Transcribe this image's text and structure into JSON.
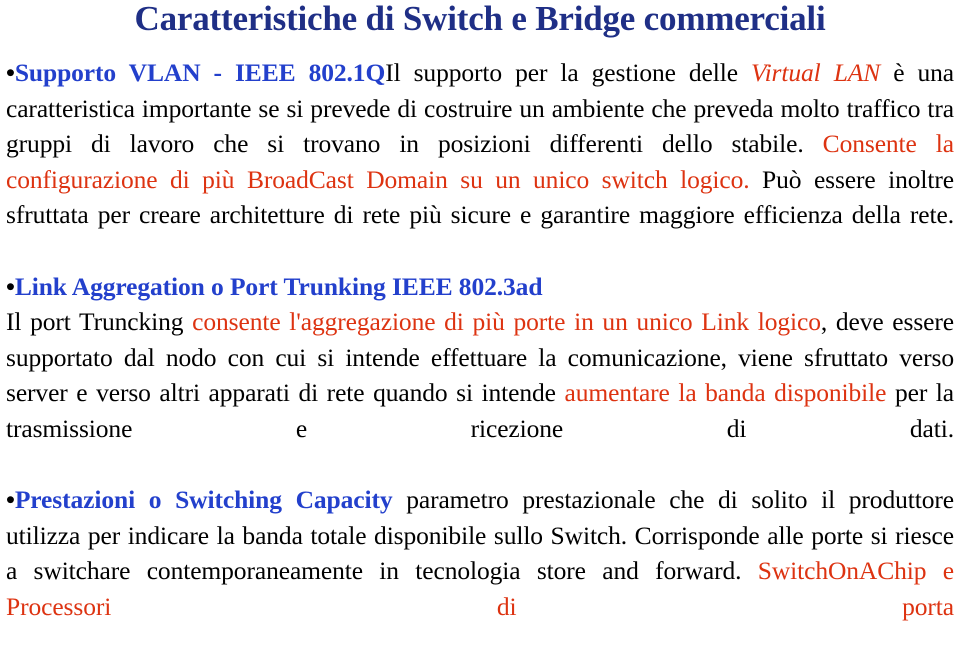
{
  "slide": {
    "title": "Caratteristiche di Switch e Bridge commerciali",
    "colors": {
      "title_blue": "#1F2F86",
      "heading_blue": "#2340CC",
      "accent_red": "#DD3311",
      "body_black": "#000000",
      "background": "#FFFFFF"
    },
    "bullets": [
      {
        "marker": "•",
        "heading": "Supporto VLAN - IEEE 802.1Q",
        "runs": [
          {
            "text": "Il supporto per la gestione delle ",
            "style": "black"
          },
          {
            "text": "Virtual LAN",
            "style": "red-italic"
          },
          {
            "text": " è una caratteristica importante se si prevede di costruire un ambiente che preveda molto traffico tra gruppi di lavoro che si trovano in posizioni differenti dello stabile. ",
            "style": "black"
          },
          {
            "text": "Consente la configurazione di più BroadCast Domain su un unico switch logico.",
            "style": "red"
          },
          {
            "text": " Può essere inoltre sfruttata per creare architetture di rete più sicure e garantire maggiore efficienza della rete.",
            "style": "black"
          }
        ]
      },
      {
        "marker": "•",
        "heading": "Link Aggregation o Port Trunking IEEE 802.3ad",
        "heading_on_own_line": true,
        "runs": [
          {
            "text": "Il port Truncking ",
            "style": "black"
          },
          {
            "text": "consente l'aggregazione di più porte in un unico Link logico",
            "style": "red"
          },
          {
            "text": ", deve essere supportato dal nodo con cui si intende effettuare la comunicazione, viene sfruttato verso server e verso altri apparati di rete quando si intende ",
            "style": "black"
          },
          {
            "text": "aumentare la banda disponibile",
            "style": "red"
          },
          {
            "text": " per la trasmissione e ricezione di dati.",
            "style": "black"
          }
        ]
      },
      {
        "marker": "•",
        "heading": "Prestazioni o Switching Capacity",
        "runs": [
          {
            "text": "parametro prestazionale che di solito il produttore utilizza per indicare la banda totale disponibile sullo Switch. Corrisponde alle porte si riesce a switchare contemporaneamente in tecnologia store and forward. ",
            "style": "black"
          },
          {
            "text": "SwitchOnAChip e Processori di porta",
            "style": "red"
          }
        ]
      }
    ]
  }
}
